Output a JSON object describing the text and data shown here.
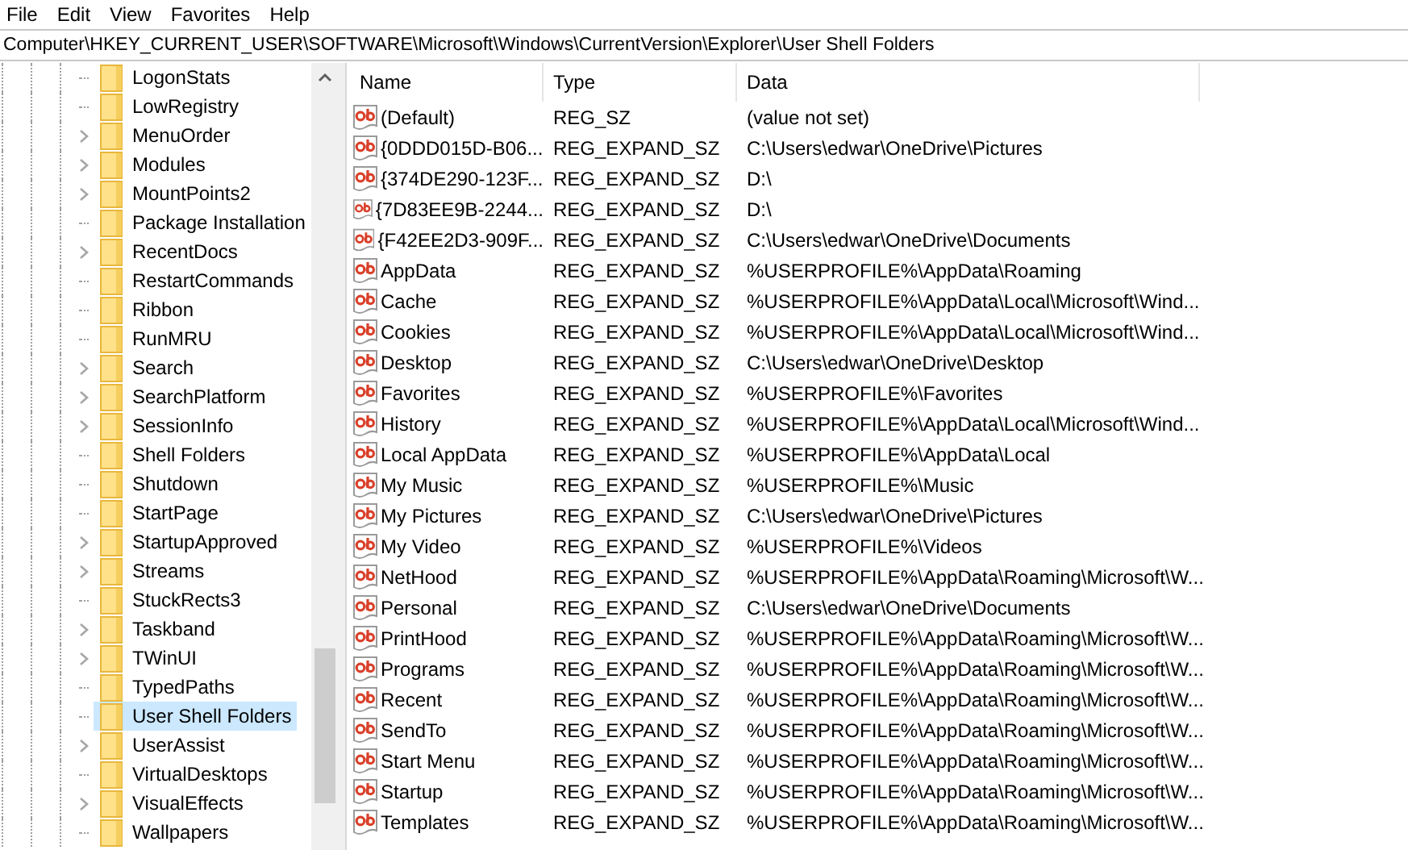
{
  "menu": [
    "File",
    "Edit",
    "View",
    "Favorites",
    "Help"
  ],
  "address": "Computer\\HKEY_CURRENT_USER\\SOFTWARE\\Microsoft\\Windows\\CurrentVersion\\Explorer\\User Shell Folders",
  "tree": {
    "items": [
      {
        "label": "LogonStats",
        "expandable": false,
        "selected": false
      },
      {
        "label": "LowRegistry",
        "expandable": false,
        "selected": false
      },
      {
        "label": "MenuOrder",
        "expandable": true,
        "selected": false
      },
      {
        "label": "Modules",
        "expandable": true,
        "selected": false
      },
      {
        "label": "MountPoints2",
        "expandable": true,
        "selected": false
      },
      {
        "label": "Package Installation",
        "expandable": false,
        "selected": false
      },
      {
        "label": "RecentDocs",
        "expandable": true,
        "selected": false
      },
      {
        "label": "RestartCommands",
        "expandable": false,
        "selected": false
      },
      {
        "label": "Ribbon",
        "expandable": false,
        "selected": false
      },
      {
        "label": "RunMRU",
        "expandable": false,
        "selected": false
      },
      {
        "label": "Search",
        "expandable": true,
        "selected": false
      },
      {
        "label": "SearchPlatform",
        "expandable": true,
        "selected": false
      },
      {
        "label": "SessionInfo",
        "expandable": true,
        "selected": false
      },
      {
        "label": "Shell Folders",
        "expandable": false,
        "selected": false
      },
      {
        "label": "Shutdown",
        "expandable": false,
        "selected": false
      },
      {
        "label": "StartPage",
        "expandable": false,
        "selected": false
      },
      {
        "label": "StartupApproved",
        "expandable": true,
        "selected": false
      },
      {
        "label": "Streams",
        "expandable": true,
        "selected": false
      },
      {
        "label": "StuckRects3",
        "expandable": false,
        "selected": false
      },
      {
        "label": "Taskband",
        "expandable": true,
        "selected": false
      },
      {
        "label": "TWinUI",
        "expandable": true,
        "selected": false
      },
      {
        "label": "TypedPaths",
        "expandable": false,
        "selected": false
      },
      {
        "label": "User Shell Folders",
        "expandable": false,
        "selected": true
      },
      {
        "label": "UserAssist",
        "expandable": true,
        "selected": false
      },
      {
        "label": "VirtualDesktops",
        "expandable": false,
        "selected": false
      },
      {
        "label": "VisualEffects",
        "expandable": true,
        "selected": false
      },
      {
        "label": "Wallpapers",
        "expandable": false,
        "selected": false
      }
    ]
  },
  "list": {
    "columns": [
      "Name",
      "Type",
      "Data"
    ],
    "rows": [
      {
        "name": "(Default)",
        "type": "REG_SZ",
        "data": "(value not set)"
      },
      {
        "name": "{0DDD015D-B06...",
        "type": "REG_EXPAND_SZ",
        "data": "C:\\Users\\edwar\\OneDrive\\Pictures"
      },
      {
        "name": "{374DE290-123F...",
        "type": "REG_EXPAND_SZ",
        "data": "D:\\"
      },
      {
        "name": "{7D83EE9B-2244...",
        "type": "REG_EXPAND_SZ",
        "data": "D:\\"
      },
      {
        "name": "{F42EE2D3-909F...",
        "type": "REG_EXPAND_SZ",
        "data": "C:\\Users\\edwar\\OneDrive\\Documents"
      },
      {
        "name": "AppData",
        "type": "REG_EXPAND_SZ",
        "data": "%USERPROFILE%\\AppData\\Roaming"
      },
      {
        "name": "Cache",
        "type": "REG_EXPAND_SZ",
        "data": "%USERPROFILE%\\AppData\\Local\\Microsoft\\Wind..."
      },
      {
        "name": "Cookies",
        "type": "REG_EXPAND_SZ",
        "data": "%USERPROFILE%\\AppData\\Local\\Microsoft\\Wind..."
      },
      {
        "name": "Desktop",
        "type": "REG_EXPAND_SZ",
        "data": "C:\\Users\\edwar\\OneDrive\\Desktop"
      },
      {
        "name": "Favorites",
        "type": "REG_EXPAND_SZ",
        "data": "%USERPROFILE%\\Favorites"
      },
      {
        "name": "History",
        "type": "REG_EXPAND_SZ",
        "data": "%USERPROFILE%\\AppData\\Local\\Microsoft\\Wind..."
      },
      {
        "name": "Local AppData",
        "type": "REG_EXPAND_SZ",
        "data": "%USERPROFILE%\\AppData\\Local"
      },
      {
        "name": "My Music",
        "type": "REG_EXPAND_SZ",
        "data": "%USERPROFILE%\\Music"
      },
      {
        "name": "My Pictures",
        "type": "REG_EXPAND_SZ",
        "data": "C:\\Users\\edwar\\OneDrive\\Pictures"
      },
      {
        "name": "My Video",
        "type": "REG_EXPAND_SZ",
        "data": "%USERPROFILE%\\Videos"
      },
      {
        "name": "NetHood",
        "type": "REG_EXPAND_SZ",
        "data": "%USERPROFILE%\\AppData\\Roaming\\Microsoft\\W..."
      },
      {
        "name": "Personal",
        "type": "REG_EXPAND_SZ",
        "data": "C:\\Users\\edwar\\OneDrive\\Documents"
      },
      {
        "name": "PrintHood",
        "type": "REG_EXPAND_SZ",
        "data": "%USERPROFILE%\\AppData\\Roaming\\Microsoft\\W..."
      },
      {
        "name": "Programs",
        "type": "REG_EXPAND_SZ",
        "data": "%USERPROFILE%\\AppData\\Roaming\\Microsoft\\W..."
      },
      {
        "name": "Recent",
        "type": "REG_EXPAND_SZ",
        "data": "%USERPROFILE%\\AppData\\Roaming\\Microsoft\\W..."
      },
      {
        "name": "SendTo",
        "type": "REG_EXPAND_SZ",
        "data": "%USERPROFILE%\\AppData\\Roaming\\Microsoft\\W..."
      },
      {
        "name": "Start Menu",
        "type": "REG_EXPAND_SZ",
        "data": "%USERPROFILE%\\AppData\\Roaming\\Microsoft\\W..."
      },
      {
        "name": "Startup",
        "type": "REG_EXPAND_SZ",
        "data": "%USERPROFILE%\\AppData\\Roaming\\Microsoft\\W..."
      },
      {
        "name": "Templates",
        "type": "REG_EXPAND_SZ",
        "data": "%USERPROFILE%\\AppData\\Roaming\\Microsoft\\W..."
      }
    ]
  }
}
